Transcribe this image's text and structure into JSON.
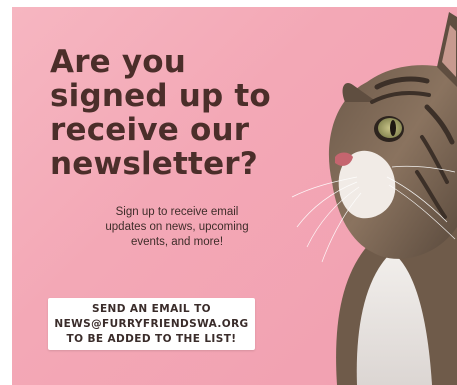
{
  "poster": {
    "headline": [
      "Are you",
      "signed up to",
      "receive our",
      "newsletter?"
    ],
    "subtext": [
      "Sign up to receive email",
      "updates on news, upcoming",
      "events, and more!"
    ],
    "cta": [
      "SEND AN EMAIL TO",
      "NEWS@FURRYFRIENDSWA.ORG",
      "TO BE ADDED TO THE LIST!"
    ]
  },
  "colors": {
    "background": "#f4adbb",
    "headline": "#4b2e2a",
    "cta_background": "#ffffff",
    "cta_text": "#3a2c2a"
  },
  "image": {
    "subject": "tabby-cat-photo"
  }
}
